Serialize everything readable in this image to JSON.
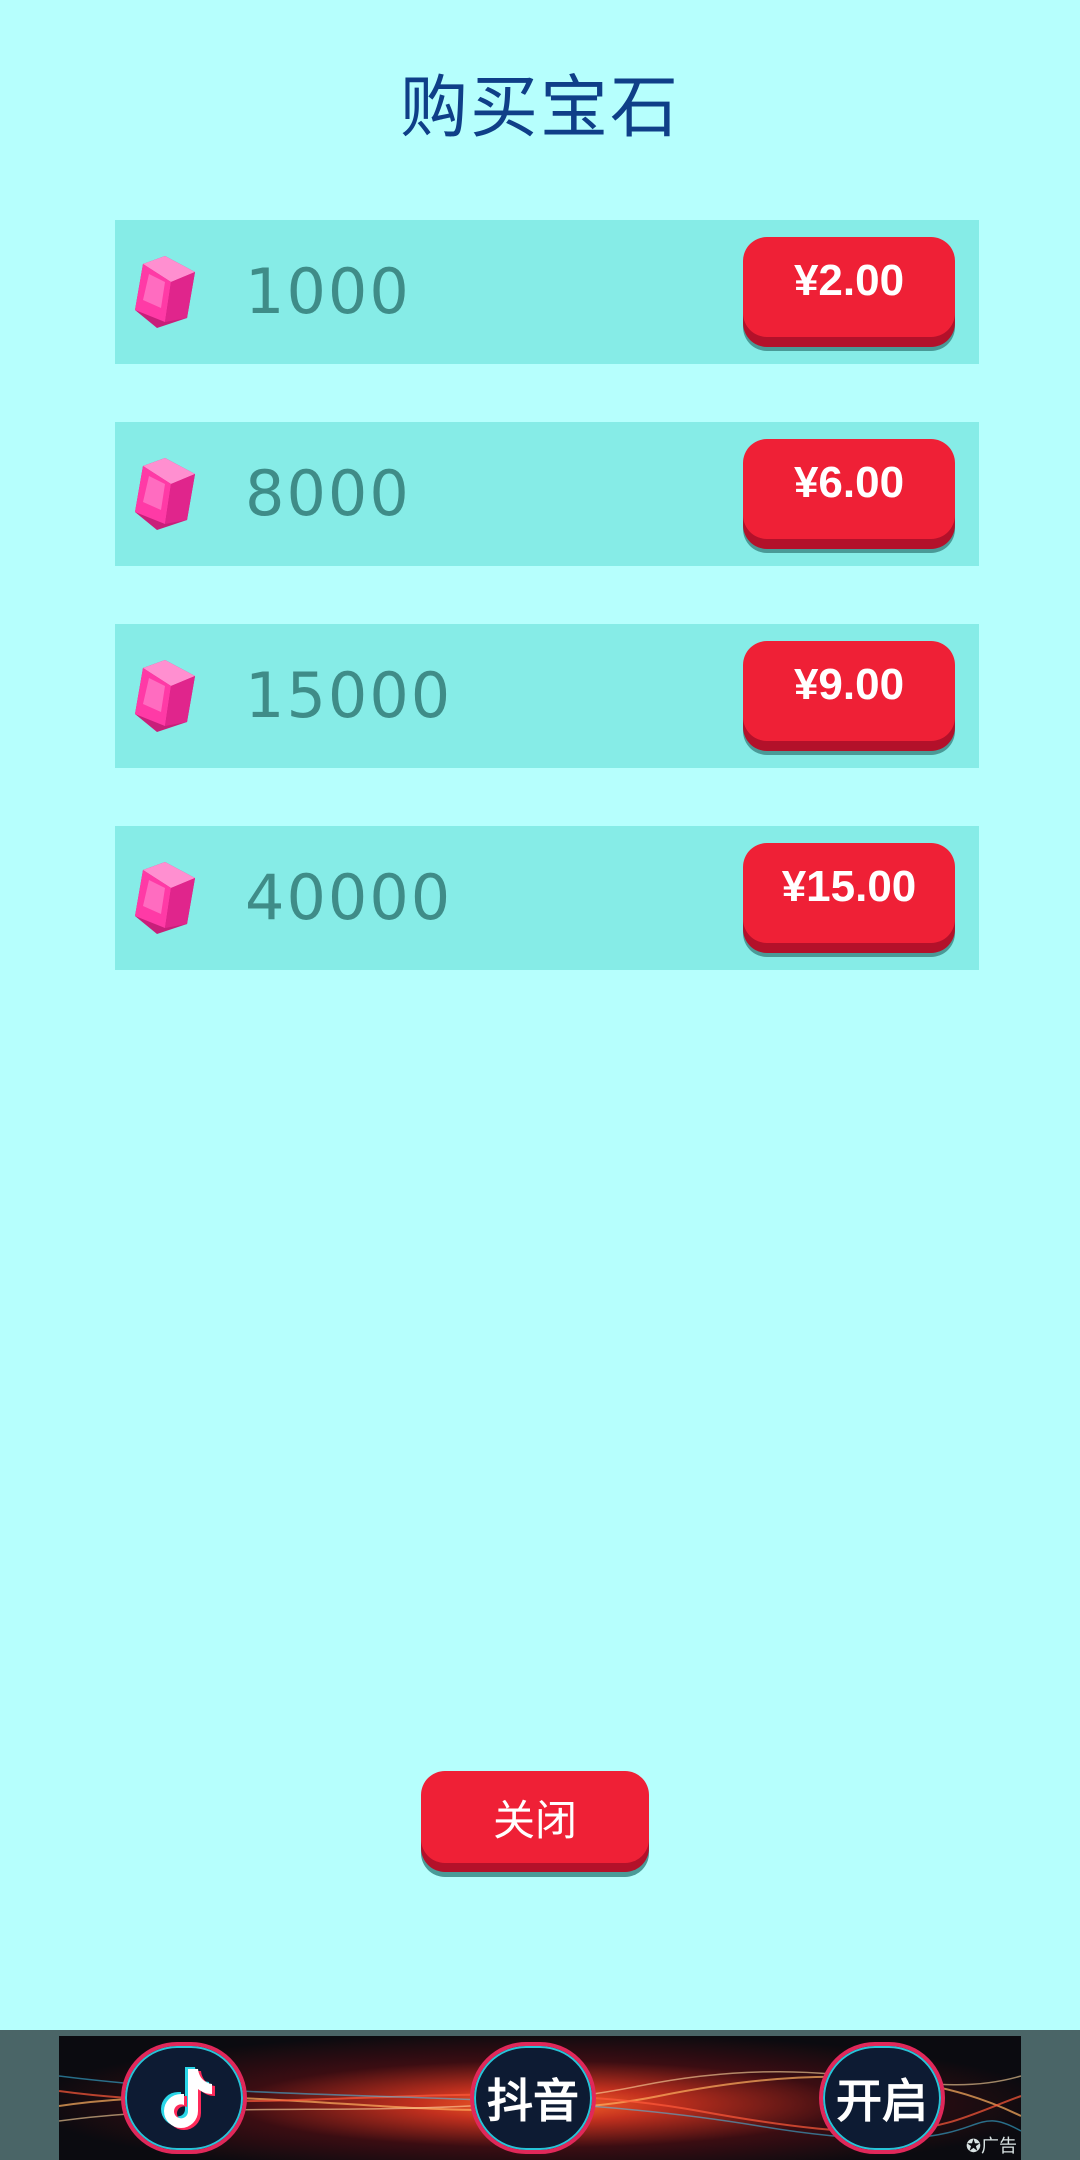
{
  "page": {
    "title": "购买宝石"
  },
  "packages": [
    {
      "amount": "1000",
      "price": "¥2.00"
    },
    {
      "amount": "8000",
      "price": "¥6.00"
    },
    {
      "amount": "15000",
      "price": "¥9.00"
    },
    {
      "amount": "40000",
      "price": "¥15.00"
    }
  ],
  "close_label": "关闭",
  "ad": {
    "douyin_text": "抖音",
    "open_text": "开启",
    "tag": "广告"
  },
  "icons": {
    "gem": "gem-icon",
    "tiktok": "tiktok-logo-icon",
    "ad_badge": "ad-badge-icon"
  },
  "colors": {
    "background": "#b6fffd",
    "row": "#86ece7",
    "button": "#ef2036",
    "title": "#0f3f88"
  }
}
